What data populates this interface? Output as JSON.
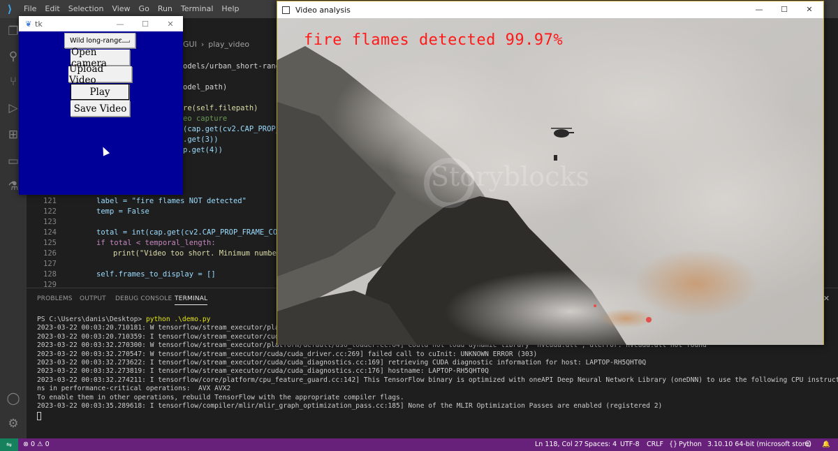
{
  "vscode": {
    "menu": [
      "File",
      "Edit",
      "Selection",
      "View",
      "Go",
      "Run",
      "Terminal",
      "Help"
    ],
    "breadcrumb": [
      "GUI",
      "play_video"
    ],
    "code_fragments": {
      "c1": "odels/urban_short-range_",
      "c2": "odel_path)",
      "c3": "re(self.filepath)",
      "c4": "eo capture",
      "c5": "(cap.get(cv2.CAP_PROP_F",
      "c6": ".get(3))",
      "c7": "p.get(4))"
    },
    "code_lines": [
      {
        "n": "121",
        "text": "label = \"fire flames NOT detected\""
      },
      {
        "n": "122",
        "text": "temp = False"
      },
      {
        "n": "123",
        "text": ""
      },
      {
        "n": "124",
        "text": "total = int(cap.get(cv2.CAP_PROP_FRAME_COUN"
      },
      {
        "n": "125",
        "text": "if total < temporal_length:"
      },
      {
        "n": "126",
        "text": "print(\"Video too short. Minimum number"
      },
      {
        "n": "127",
        "text": ""
      },
      {
        "n": "128",
        "text": "self.frames_to_display = []"
      },
      {
        "n": "129",
        "text": ""
      }
    ],
    "panel_tabs": [
      "PROBLEMS",
      "OUTPUT",
      "DEBUG CONSOLE",
      "TERMINAL"
    ],
    "terminal": {
      "prompt": "PS C:\\Users\\danis\\Desktop> ",
      "command": "python .\\demo.py",
      "lines": [
        "2023-03-22 00:03:20.710181: W tensorflow/stream_executor/platf",
        "2023-03-22 00:03:20.710359: I tensorflow/stream_executor/cuda",
        "2023-03-22 00:03:32.270300: W tensorflow/stream_executor/platform/default/dso_loader.cc:64] Could not load dynamic library 'nvcuda.dll'; dlerror: nvcuda.dll not found",
        "2023-03-22 00:03:32.270547: W tensorflow/stream_executor/cuda/cuda_driver.cc:269] failed call to cuInit: UNKNOWN ERROR (303)",
        "2023-03-22 00:03:32.273622: I tensorflow/stream_executor/cuda/cuda_diagnostics.cc:169] retrieving CUDA diagnostic information for host: LAPTOP-RH5QHT0Q",
        "2023-03-22 00:03:32.273819: I tensorflow/stream_executor/cuda/cuda_diagnostics.cc:176] hostname: LAPTOP-RH5QHT0Q",
        "2023-03-22 00:03:32.274211: I tensorflow/core/platform/cpu_feature_guard.cc:142] This TensorFlow binary is optimized with oneAPI Deep Neural Network Library (oneDNN) to use the following CPU instructio",
        "ns in performance-critical operations:  AVX AVX2",
        "To enable them in other operations, rebuild TensorFlow with the appropriate compiler flags.",
        "2023-03-22 00:03:35.289618: I tensorflow/compiler/mlir/mlir_graph_optimization_pass.cc:185] None of the MLIR Optimization Passes are enabled (registered 2)"
      ]
    },
    "status": {
      "problems": "⊗ 0 ⚠ 0",
      "position": "Ln 118, Col 27",
      "spaces": "Spaces: 4",
      "encoding": "UTF-8",
      "eol": "CRLF",
      "language": "Python",
      "interpreter": "3.10.10 64-bit (microsoft store)"
    }
  },
  "tk": {
    "title": "tk",
    "option_value": "Wild long-range",
    "buttons": [
      "Open camera",
      "Upload Video",
      "Play",
      "Save Video"
    ]
  },
  "video": {
    "title": "Video analysis",
    "detection": "fire flames detected 99.97%",
    "watermark": "Storyblocks"
  }
}
